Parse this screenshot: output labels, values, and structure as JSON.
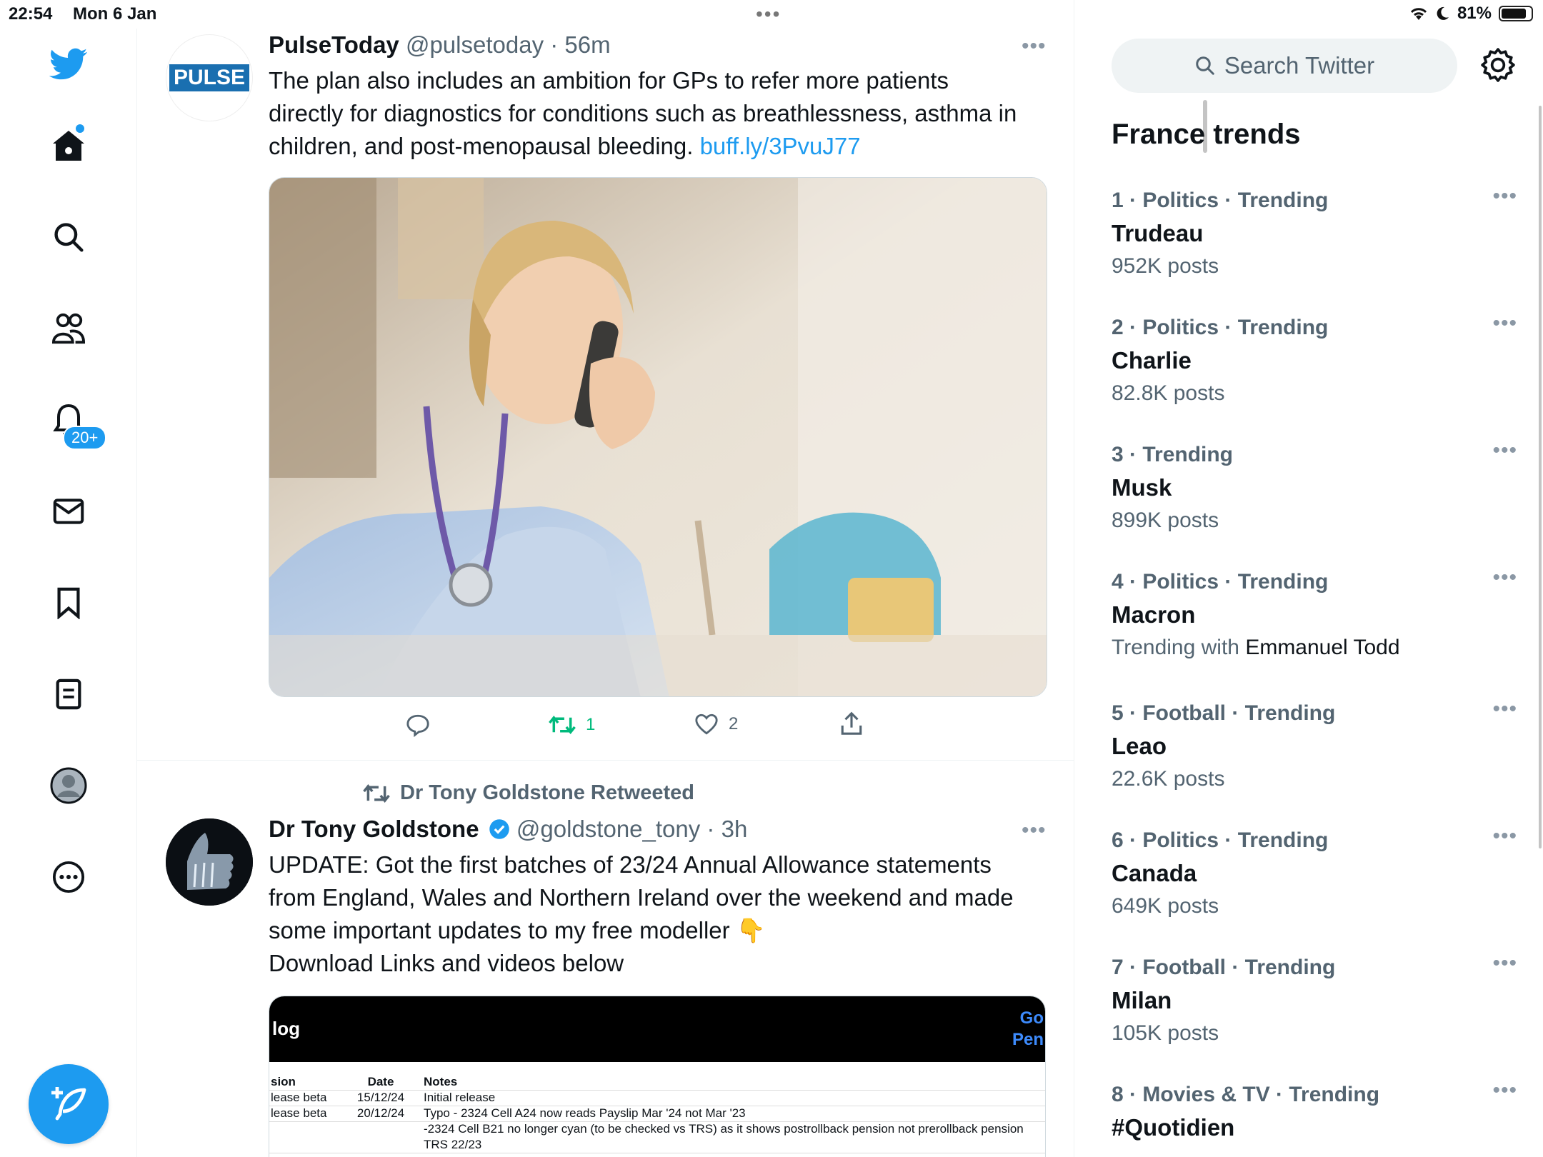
{
  "status_bar": {
    "time": "22:54",
    "date": "Mon 6 Jan",
    "battery": "81%"
  },
  "sidebar": {
    "notifications_badge": "20+",
    "items": [
      {
        "name": "twitter-logo",
        "icon": "bird"
      },
      {
        "name": "home",
        "icon": "home"
      },
      {
        "name": "explore",
        "icon": "search"
      },
      {
        "name": "communities",
        "icon": "people"
      },
      {
        "name": "notifications",
        "icon": "bell"
      },
      {
        "name": "messages",
        "icon": "envelope"
      },
      {
        "name": "bookmarks",
        "icon": "bookmark"
      },
      {
        "name": "lists",
        "icon": "document"
      },
      {
        "name": "profile",
        "icon": "avatar"
      },
      {
        "name": "more",
        "icon": "ellipsis-circle"
      }
    ]
  },
  "tweet1": {
    "avatar_text": "PULSE",
    "name": "PulseToday",
    "handle": "@pulsetoday",
    "time": "56m",
    "text": "The plan also includes an ambition for GPs to refer more patients directly for diagnostics for conditions such as breathlessness, asthma in children, and post-menopausal bleeding. ",
    "link": "buff.ly/3PvuJ77",
    "retweets": "1",
    "likes": "2"
  },
  "retweet_label": "Dr Tony Goldstone Retweeted",
  "tweet2": {
    "name": "Dr Tony Goldstone",
    "handle": "@goldstone_tony",
    "time": "3h",
    "line1": "UPDATE: Got the first batches of 23/24 Annual Allowance statements",
    "line2": "from England, Wales and Northern Ireland over the weekend and made",
    "line3": "some important updates to my free modeller 👇",
    "line4": "Download Links and videos below",
    "sheet": {
      "title": "log",
      "right_top": "Go",
      "right_bottom": "Pen",
      "headers": [
        "sion",
        "Date",
        "Notes"
      ],
      "rows": [
        [
          "lease beta",
          "15/12/24",
          "Initial release"
        ],
        [
          "lease beta",
          "20/12/24",
          "Typo - 2324 Cell A24 now reads Payslip Mar '24 not Mar '23"
        ],
        [
          "",
          "",
          "-2324 Cell B21 no longer cyan (to be checked vs TRS) as it shows postrollback pension not prerollback pension"
        ],
        [
          "",
          "",
          "TRS 22/23"
        ]
      ]
    }
  },
  "search": {
    "placeholder": "Search Twitter"
  },
  "trends": {
    "title": "France trends",
    "items": [
      {
        "meta": "1 · Politics · Trending",
        "name": "Trudeau",
        "sub": "952K posts"
      },
      {
        "meta": "2 · Politics · Trending",
        "name": "Charlie",
        "sub": "82.8K posts"
      },
      {
        "meta": "3 · Trending",
        "name": "Musk",
        "sub": "899K posts"
      },
      {
        "meta": "4 · Politics · Trending",
        "name": "Macron",
        "sub_prefix": "Trending with ",
        "sub_strong": "Emmanuel Todd"
      },
      {
        "meta": "5 · Football · Trending",
        "name": "Leao",
        "sub": "22.6K posts"
      },
      {
        "meta": "6 · Politics · Trending",
        "name": "Canada",
        "sub": "649K posts"
      },
      {
        "meta": "7 · Football · Trending",
        "name": "Milan",
        "sub": "105K posts"
      },
      {
        "meta": "8 · Movies & TV · Trending",
        "name": "#Quotidien"
      }
    ]
  },
  "colors": {
    "accent": "#1d9bf0",
    "secondary_text": "#536471",
    "retweet_green": "#00ba7c"
  }
}
